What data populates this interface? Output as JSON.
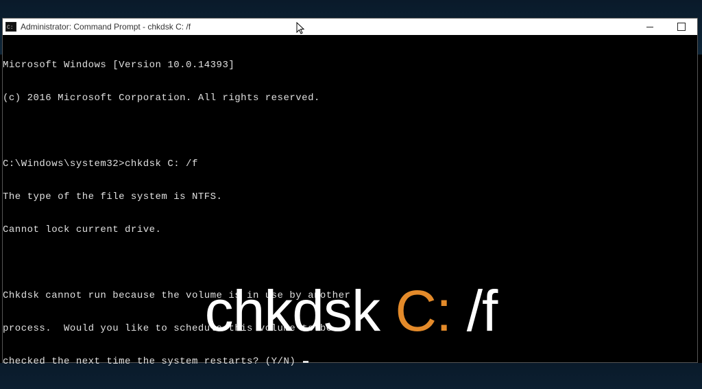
{
  "window": {
    "title": "Administrator: Command Prompt - chkdsk  C: /f"
  },
  "console": {
    "lines": [
      "Microsoft Windows [Version 10.0.14393]",
      "(c) 2016 Microsoft Corporation. All rights reserved.",
      "",
      "C:\\Windows\\system32>chkdsk C: /f",
      "The type of the file system is NTFS.",
      "Cannot lock current drive.",
      "",
      "Chkdsk cannot run because the volume is in use by another",
      "process.  Would you like to schedule this volume to be",
      "checked the next time the system restarts? (Y/N) "
    ]
  },
  "overlay": {
    "part1": "chkdsk ",
    "accent": "C:",
    "part2": " /f"
  },
  "colors": {
    "accent": "#e38a2a",
    "console_fg": "#e0e0e0",
    "console_bg": "#000000"
  }
}
